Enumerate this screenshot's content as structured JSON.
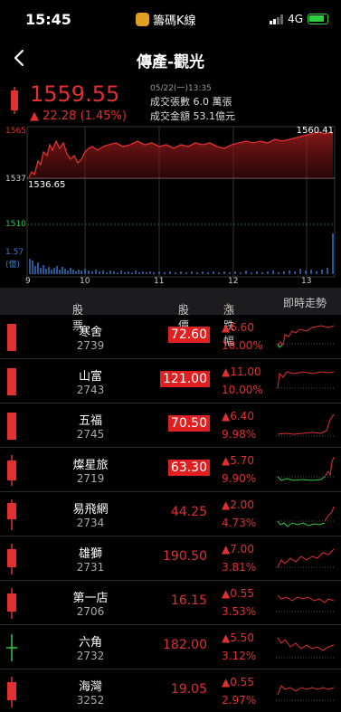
{
  "status": {
    "time": "15:45",
    "app_name": "籌碼K線",
    "network": "4G"
  },
  "header": {
    "title": "傳產-觀光"
  },
  "summary": {
    "price": "1559.55",
    "change": "▲ 22.28 (1.45%)",
    "datetime": "05/22(一)13:35",
    "volume_label": "成交張數",
    "volume_value": "6.0 萬張",
    "amount_label": "成交金額",
    "amount_value": "53.1億元"
  },
  "chart": {
    "y_top": "1565",
    "y_mid": "1537",
    "y_low": "1510",
    "vol_top": "1.57",
    "vol_unit": "(億)",
    "high_label": "1560.41",
    "low_label": "1536.65",
    "x_labels": [
      "9",
      "10",
      "11",
      "12",
      "13"
    ]
  },
  "table": {
    "col_stock": "股票",
    "col_price": "股價",
    "col_change": "漲跌幅",
    "col_trend": "即時走勢",
    "rows": [
      {
        "name": "寒舍",
        "code": "2739",
        "price": "72.60",
        "limit": true,
        "change": "▲6.60",
        "pct": "10.00%",
        "candle": "up-bar"
      },
      {
        "name": "山富",
        "code": "2743",
        "price": "121.00",
        "limit": true,
        "change": "▲11.00",
        "pct": "10.00%",
        "candle": "up-bar"
      },
      {
        "name": "五福",
        "code": "2745",
        "price": "70.50",
        "limit": true,
        "change": "▲6.40",
        "pct": "9.98%",
        "candle": "up-bar"
      },
      {
        "name": "燦星旅",
        "code": "2719",
        "price": "63.30",
        "limit": true,
        "change": "▲5.70",
        "pct": "9.90%",
        "candle": "up-wick"
      },
      {
        "name": "易飛網",
        "code": "2734",
        "price": "44.25",
        "limit": false,
        "change": "▲2.00",
        "pct": "4.73%",
        "candle": "up-wick"
      },
      {
        "name": "雄獅",
        "code": "2731",
        "price": "190.50",
        "limit": false,
        "change": "▲7.00",
        "pct": "3.81%",
        "candle": "up-wick"
      },
      {
        "name": "第一店",
        "code": "2706",
        "price": "16.15",
        "limit": false,
        "change": "▲0.55",
        "pct": "3.53%",
        "candle": "up-wick"
      },
      {
        "name": "六角",
        "code": "2732",
        "price": "182.00",
        "limit": false,
        "change": "▲5.50",
        "pct": "3.12%",
        "candle": "doji"
      },
      {
        "name": "海灣",
        "code": "3252",
        "price": "19.05",
        "limit": false,
        "change": "▲0.55",
        "pct": "2.97%",
        "candle": "up-wick"
      }
    ]
  },
  "colors": {
    "up": "#e03030",
    "down": "#2ecc40",
    "accent": "#e0a030",
    "volume": "#3a7bd5"
  }
}
